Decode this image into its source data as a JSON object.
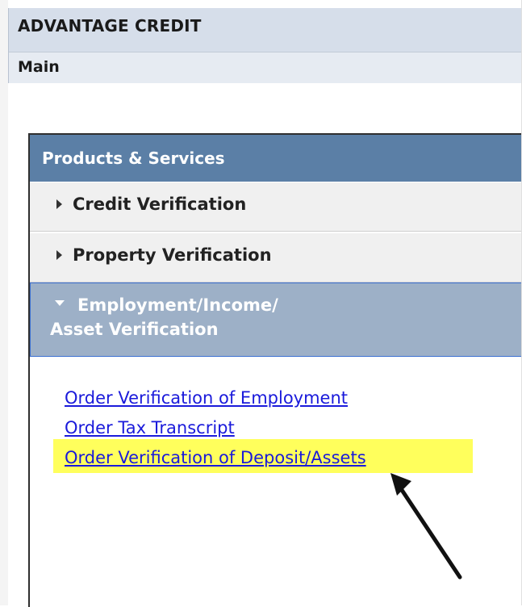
{
  "header": {
    "company_name": "ADVANTAGE CREDIT",
    "subnav_label": "Main"
  },
  "panel": {
    "title": "Products & Services",
    "menu": [
      {
        "label": "Credit Verification",
        "state": "collapsed"
      },
      {
        "label": "Property Verification",
        "state": "collapsed"
      },
      {
        "label_line1": "Employment/Income/",
        "label_line2": "Asset Verification",
        "state": "expanded"
      }
    ],
    "links": [
      "Order Verification of Employment",
      "Order Tax Transcript",
      "Order Verification of Deposit/Assets"
    ],
    "highlighted_link_index": 2
  },
  "colors": {
    "panel_header": "#5b7fa6",
    "expanded_row": "#9db0c7",
    "link": "#1a1adb",
    "highlight": "#ffff5c"
  }
}
